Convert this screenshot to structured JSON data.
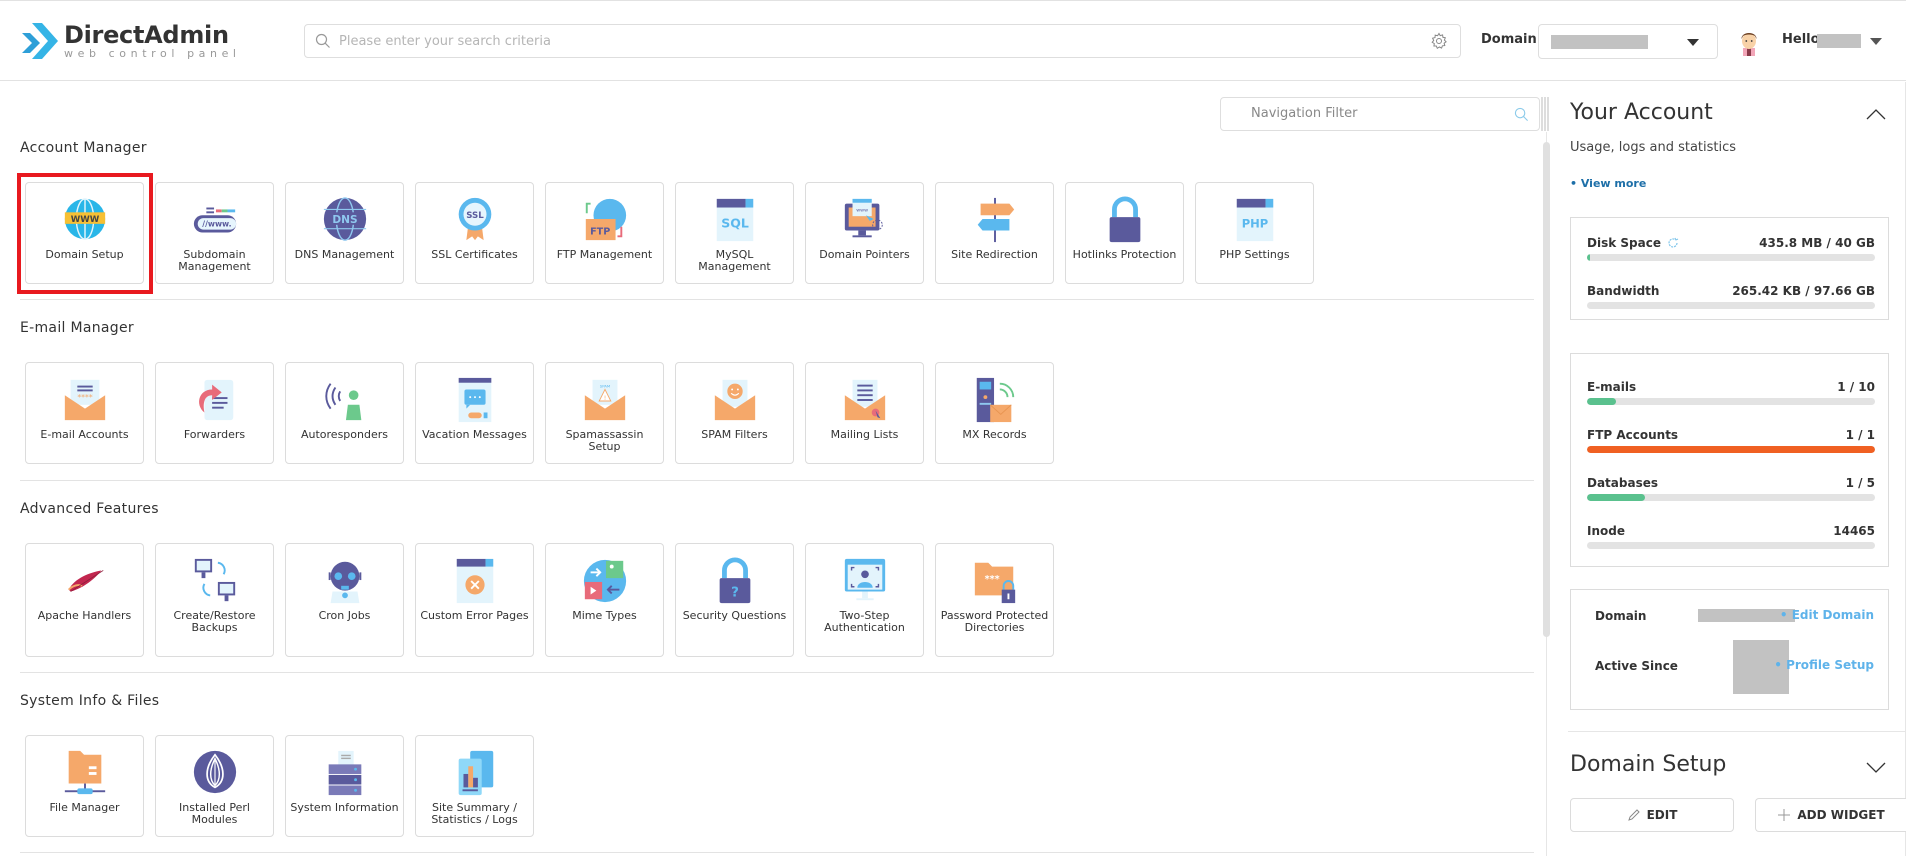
{
  "header": {
    "logo_title": "DirectAdmin",
    "logo_subtitle": "web control panel",
    "search_placeholder": "Please enter your search criteria",
    "domain_label": "Domain",
    "domain_value": "",
    "greeting": "Hello,",
    "username": ""
  },
  "main": {
    "nav_filter_placeholder": "Navigation Filter",
    "sections": [
      {
        "title": "Account Manager",
        "items": [
          {
            "label": "Domain Setup",
            "icon": "globe-www-icon",
            "highlighted": true
          },
          {
            "label": "Subdomain Management",
            "icon": "subdomain-icon"
          },
          {
            "label": "DNS Management",
            "icon": "dns-globe-icon"
          },
          {
            "label": "SSL Certificates",
            "icon": "ssl-badge-icon"
          },
          {
            "label": "FTP Management",
            "icon": "ftp-folder-icon"
          },
          {
            "label": "MySQL Management",
            "icon": "sql-file-icon"
          },
          {
            "label": "Domain Pointers",
            "icon": "monitor-www-icon"
          },
          {
            "label": "Site Redirection",
            "icon": "signpost-icon"
          },
          {
            "label": "Hotlinks Protection",
            "icon": "padlock-icon"
          },
          {
            "label": "PHP Settings",
            "icon": "php-file-icon"
          }
        ]
      },
      {
        "title": "E-mail Manager",
        "items": [
          {
            "label": "E-mail Accounts",
            "icon": "envelope-password-icon"
          },
          {
            "label": "Forwarders",
            "icon": "forward-document-icon"
          },
          {
            "label": "Autoresponders",
            "icon": "person-broadcast-icon"
          },
          {
            "label": "Vacation Messages",
            "icon": "vacation-chat-icon"
          },
          {
            "label": "Spamassassin Setup",
            "icon": "envelope-spam-warning-icon"
          },
          {
            "label": "SPAM Filters",
            "icon": "envelope-smiley-icon"
          },
          {
            "label": "Mailing Lists",
            "icon": "envelope-list-icon"
          },
          {
            "label": "MX Records",
            "icon": "server-mail-icon"
          }
        ]
      },
      {
        "title": "Advanced Features",
        "items": [
          {
            "label": "Apache Handlers",
            "icon": "apache-feather-icon"
          },
          {
            "label": "Create/Restore Backups",
            "icon": "computers-sync-icon"
          },
          {
            "label": "Cron Jobs",
            "icon": "robot-icon"
          },
          {
            "label": "Custom Error Pages",
            "icon": "error-page-icon"
          },
          {
            "label": "Mime Types",
            "icon": "mime-circle-icon"
          },
          {
            "label": "Security Questions",
            "icon": "padlock-question-icon"
          },
          {
            "label": "Two-Step Authentication",
            "icon": "monitor-face-scan-icon"
          },
          {
            "label": "Password Protected Directories",
            "icon": "folder-lock-icon"
          }
        ]
      },
      {
        "title": "System Info & Files",
        "items": [
          {
            "label": "File Manager",
            "icon": "folder-network-icon"
          },
          {
            "label": "Installed Perl Modules",
            "icon": "perl-onion-icon"
          },
          {
            "label": "System Information",
            "icon": "server-stack-icon"
          },
          {
            "label": "Site Summary / Statistics / Logs",
            "icon": "statistics-chart-icon"
          }
        ]
      }
    ]
  },
  "sidebar": {
    "your_account": {
      "title": "Your Account",
      "subtitle": "Usage, logs and statistics",
      "view_more": "• View more",
      "usage": [
        {
          "name": "Disk Space",
          "value": "435.8 MB / 40 GB",
          "percent": 1.1,
          "color": "#5ac18e"
        },
        {
          "name": "Bandwidth",
          "value": "265.42 KB / 97.66 GB",
          "percent": 0,
          "color": "#5ac18e"
        }
      ],
      "limits": [
        {
          "name": "E-mails",
          "value": "1 / 10",
          "percent": 10,
          "color": "#5ac18e"
        },
        {
          "name": "FTP Accounts",
          "value": "1 / 1",
          "percent": 100,
          "color": "#f06022"
        },
        {
          "name": "Databases",
          "value": "1 / 5",
          "percent": 20,
          "color": "#5ac18e"
        },
        {
          "name": "Inode",
          "value": "14465",
          "percent": 0,
          "color": "#5ac18e"
        }
      ],
      "info": {
        "domain_label": "Domain",
        "domain_value": "",
        "edit_domain": "• Edit Domain",
        "active_since_label": "Active Since",
        "active_since_value": "",
        "profile_setup": "• Profile Setup"
      }
    },
    "domain_setup": {
      "title": "Domain Setup",
      "edit_label": "EDIT",
      "add_widget_label": "ADD WIDGET"
    }
  },
  "colors": {
    "accent_blue": "#33b5e5",
    "link_blue": "#5fb3ea",
    "highlight_red": "#e8191f",
    "progress_green": "#5ac18e",
    "progress_orange": "#f06022"
  }
}
